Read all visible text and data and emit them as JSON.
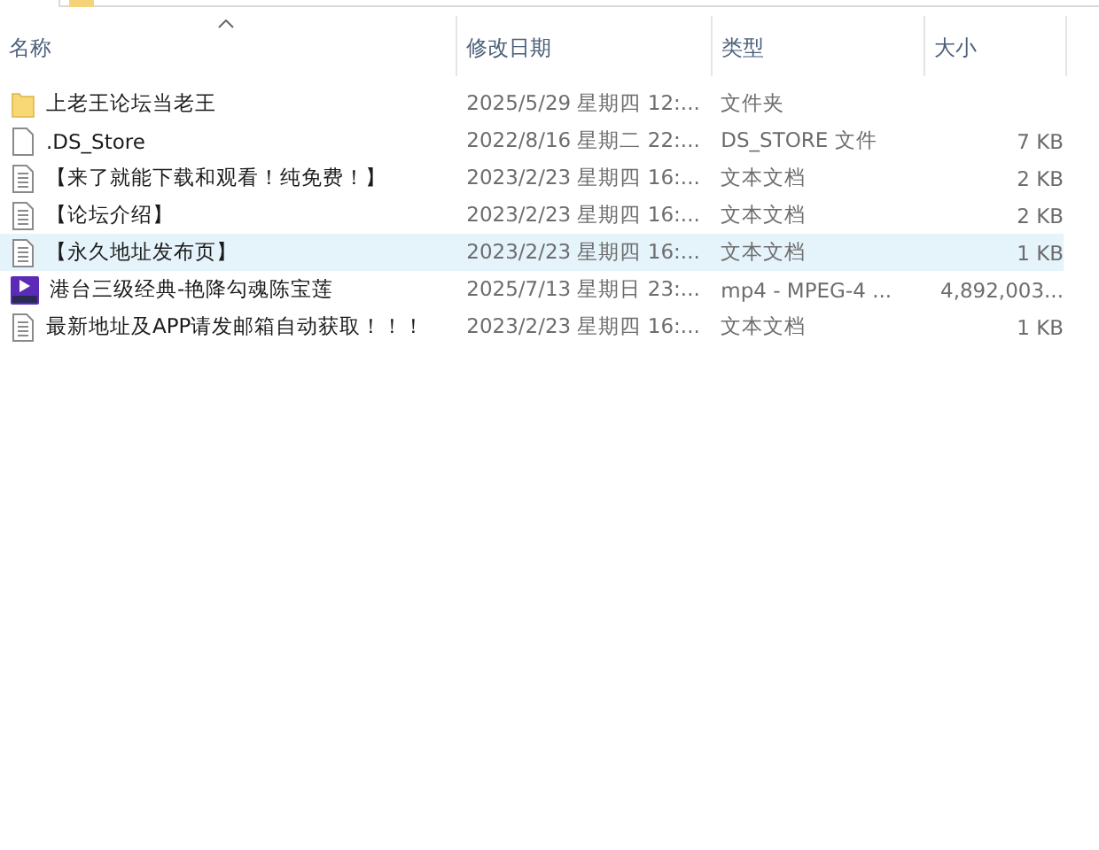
{
  "columns": [
    {
      "label": "名称",
      "sorted": true
    },
    {
      "label": "修改日期",
      "sorted": false
    },
    {
      "label": "类型",
      "sorted": false
    },
    {
      "label": "大小",
      "sorted": false
    }
  ],
  "rows": [
    {
      "kind": "folder",
      "name": "上老王论坛当老王",
      "date": "2025/5/29 星期四 12:...",
      "type": "文件夹",
      "selected": false
    },
    {
      "kind": "file",
      "name": ".DS_Store",
      "date": "2022/8/16 星期二 22:...",
      "type": "DS_STORE 文件",
      "size": "7 KB",
      "selected": false
    },
    {
      "kind": "text",
      "name": "【来了就能下载和观看！纯免费！】",
      "date": "2023/2/23 星期四 16:...",
      "type": "文本文档",
      "size": "2 KB",
      "selected": false
    },
    {
      "kind": "text",
      "name": "【论坛介绍】",
      "date": "2023/2/23 星期四 16:...",
      "type": "文本文档",
      "size": "2 KB",
      "selected": false
    },
    {
      "kind": "text",
      "name": "【永久地址发布页】",
      "date": "2023/2/23 星期四 16:...",
      "type": "文本文档",
      "size": "1 KB",
      "selected": true
    },
    {
      "kind": "video",
      "name": "港台三级经典-艳降勾魂陈宝莲",
      "date": "2025/7/13 星期日 23:...",
      "type": "mp4 - MPEG-4 ...",
      "size": "4,892,003...",
      "selected": false
    },
    {
      "kind": "text",
      "name": "最新地址及APP请发邮箱自动获取！！！",
      "date": "2023/2/23 星期四 16:...",
      "type": "文本文档",
      "size": "1 KB",
      "selected": false
    }
  ]
}
